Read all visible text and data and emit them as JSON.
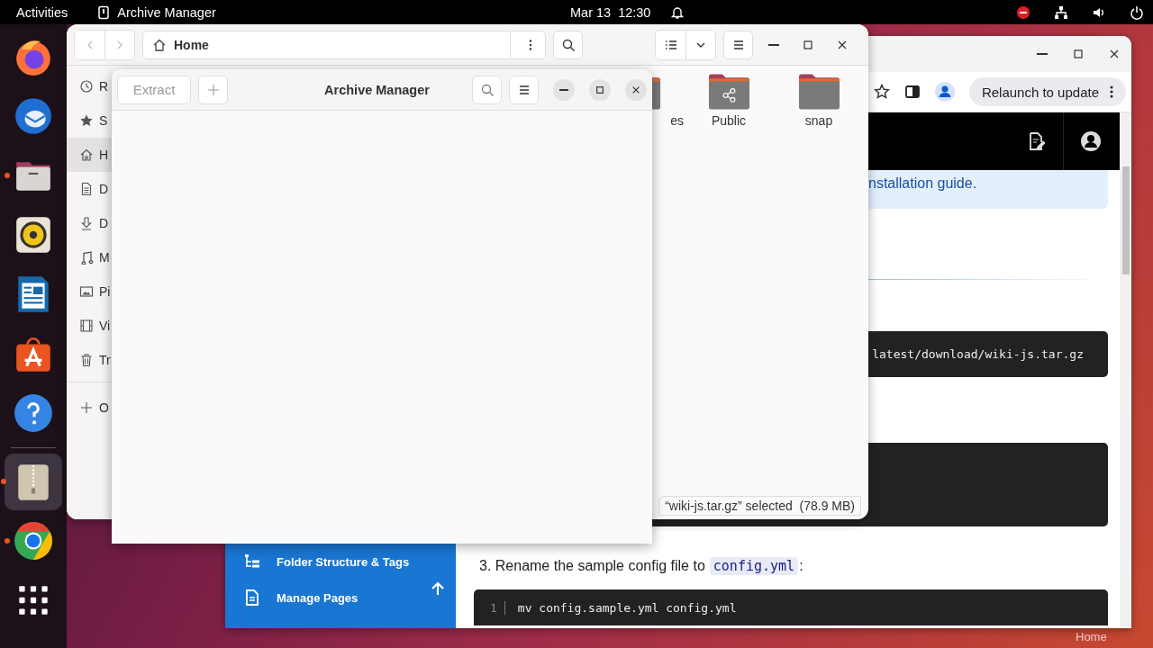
{
  "top_bar": {
    "activities": "Activities",
    "app_name": "Archive Manager",
    "date": "Mar 13",
    "time": "12:30"
  },
  "dock": [
    {
      "kind": "firefox",
      "running": false,
      "selected": false
    },
    {
      "kind": "thunderbird",
      "running": false,
      "selected": false
    },
    {
      "kind": "files",
      "running": true,
      "selected": false
    },
    {
      "kind": "rhythmbox",
      "running": false,
      "selected": false
    },
    {
      "kind": "writer",
      "running": false,
      "selected": false
    },
    {
      "kind": "appcenter",
      "running": false,
      "selected": false
    },
    {
      "kind": "help",
      "running": false,
      "selected": false
    },
    {
      "kind": "archive",
      "running": true,
      "selected": true
    },
    {
      "kind": "chrome",
      "running": true,
      "selected": false
    },
    {
      "kind": "grid",
      "running": false,
      "selected": false
    }
  ],
  "browser": {
    "relaunch": "Relaunch to update",
    "info_text": "nstallation guide.",
    "code_1": "latest/download/wiki-js.tar.gz",
    "step": "3. Rename the sample config file to",
    "step_code": "config.yml",
    "step_end": ":",
    "code_line_number": "1",
    "code_line": "mv config.sample.yml config.yml",
    "nav": [
      {
        "kind": "tree",
        "label": "Folder Structure & Tags"
      },
      {
        "kind": "pages",
        "label": "Manage Pages"
      }
    ]
  },
  "files": {
    "path": "Home",
    "sidebar": [
      {
        "kind": "recent",
        "label": "R",
        "selected": false
      },
      {
        "kind": "star",
        "label": "S",
        "selected": false
      },
      {
        "kind": "home",
        "label": "H",
        "selected": true
      },
      {
        "kind": "doc",
        "label": "D",
        "selected": false
      },
      {
        "kind": "download",
        "label": "D",
        "selected": false
      },
      {
        "kind": "music",
        "label": "M",
        "selected": false
      },
      {
        "kind": "picture",
        "label": "Pi",
        "selected": false
      },
      {
        "kind": "video",
        "label": "Vi",
        "selected": false
      },
      {
        "kind": "trash",
        "label": "Tr",
        "selected": false
      }
    ],
    "other": "O",
    "folders": [
      {
        "kind": "folder",
        "name": "es",
        "cut": true
      },
      {
        "kind": "shared",
        "name": "Public",
        "cut": false
      },
      {
        "kind": "folder",
        "name": "snap",
        "cut": false
      }
    ],
    "status": "“wiki-js.tar.gz” selected  (78.9 MB)"
  },
  "archive": {
    "title": "Archive Manager",
    "extract": {
      "label": "Extract",
      "disabled": true
    }
  },
  "desktop_label": "Home"
}
